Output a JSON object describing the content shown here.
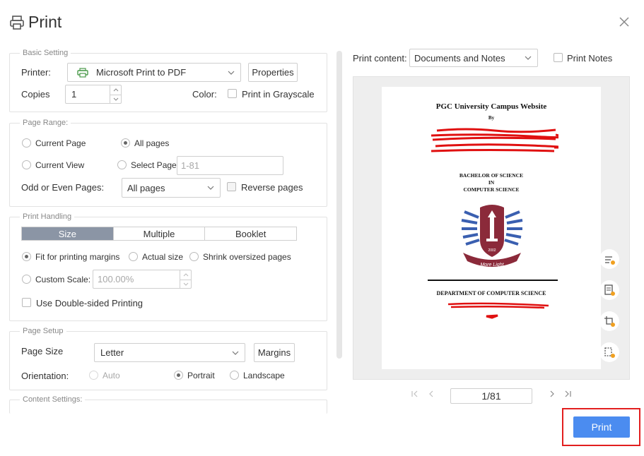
{
  "dialog": {
    "title": "Print",
    "icons": {
      "title": "printer-icon",
      "close": "close-icon"
    }
  },
  "basic_setting": {
    "legend": "Basic Setting",
    "printer_label": "Printer:",
    "printer_value": "Microsoft Print to PDF",
    "properties_label": "Properties",
    "copies_label": "Copies",
    "copies_value": "1",
    "color_label": "Color:",
    "grayscale_label": "Print in Grayscale",
    "grayscale_checked": false
  },
  "page_range": {
    "legend": "Page Range:",
    "current_page": "Current Page",
    "all_pages": "All pages",
    "current_view": "Current View",
    "select_page": "Select Page:",
    "select_page_placeholder": "1-81",
    "odd_even_label": "Odd or Even Pages:",
    "odd_even_value": "All pages",
    "reverse_label": "Reverse pages",
    "selected": "All pages"
  },
  "print_handling": {
    "legend": "Print Handling",
    "tabs": [
      "Size",
      "Multiple",
      "Booklet"
    ],
    "active_tab": "Size",
    "fit_label": "Fit for printing margins",
    "actual_label": "Actual size",
    "shrink_label": "Shrink oversized pages",
    "custom_label": "Custom Scale:",
    "custom_value": "100.00%",
    "double_sided_label": "Use Double-sided Printing"
  },
  "page_setup": {
    "legend": "Page Setup",
    "size_label": "Page Size",
    "size_value": "Letter",
    "margins_label": "Margins",
    "orientation_label": "Orientation:",
    "auto_label": "Auto",
    "portrait_label": "Portrait",
    "landscape_label": "Landscape",
    "selected": "Portrait"
  },
  "content_settings": {
    "legend": "Content Settings:"
  },
  "preview": {
    "print_content_label": "Print content:",
    "print_content_value": "Documents and Notes",
    "print_notes_label": "Print Notes",
    "document": {
      "title": "PGC University Campus Website",
      "by": "By",
      "degree_line1": "BACHELOR OF SCIENCE",
      "degree_line2": "IN",
      "degree_line3": "COMPUTER SCIENCE",
      "seal_year": "2002",
      "seal_ribbon": "More Light",
      "department": "DEPARTMENT OF COMPUTER SCIENCE"
    },
    "page_indicator": "1/81",
    "side_tools": [
      "settings-adjust-icon",
      "document-icon",
      "crop-icon",
      "page-select-icon"
    ]
  },
  "actions": {
    "print_label": "Print"
  },
  "colors": {
    "accent": "#4b8cf0",
    "highlight": "#e21f1f",
    "active_tab": "#8b95a5"
  }
}
